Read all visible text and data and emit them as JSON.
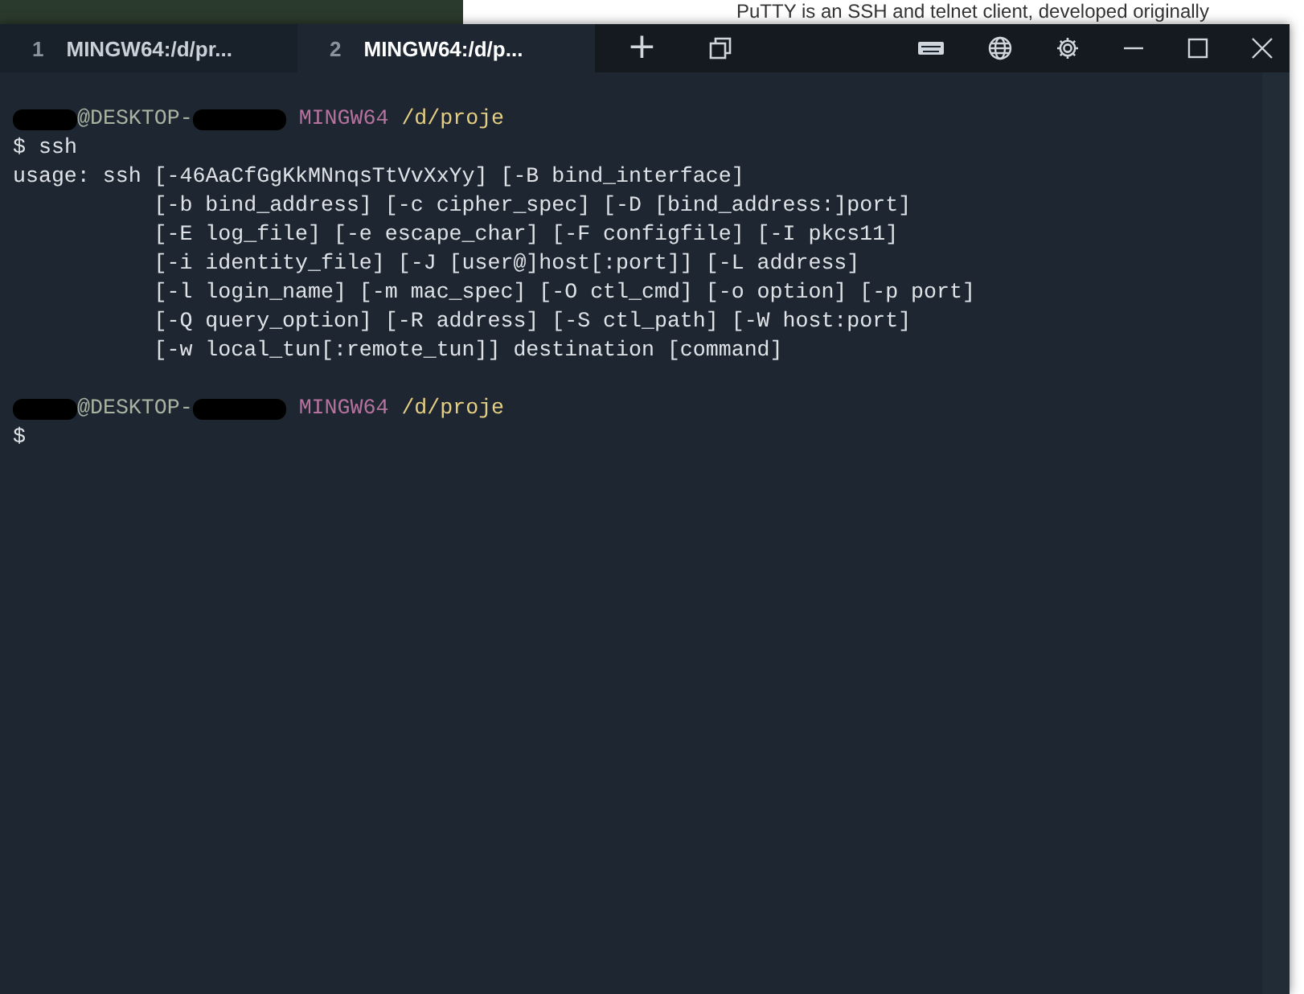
{
  "background": {
    "page_text": "PuTTY is an SSH and telnet client, developed originally"
  },
  "tabs": [
    {
      "number": "1",
      "title": "MINGW64:/d/pr...",
      "selected": false
    },
    {
      "number": "2",
      "title": "MINGW64:/d/p...",
      "selected": true
    }
  ],
  "new_tab": "+",
  "terminal": {
    "lines": [
      {
        "kind": "prompt",
        "host": "@DESKTOP-",
        "shell": "MINGW64",
        "path": "/d/proje"
      },
      {
        "kind": "command",
        "sign": "$",
        "text": "ssh"
      },
      {
        "kind": "output",
        "text": "usage: ssh [-46AaCfGgKkMNnqsTtVvXxYy] [-B bind_interface]"
      },
      {
        "kind": "continuation",
        "text": "[-b bind_address] [-c cipher_spec] [-D [bind_address:]port]"
      },
      {
        "kind": "continuation",
        "text": "[-E log_file] [-e escape_char] [-F configfile] [-I pkcs11]"
      },
      {
        "kind": "continuation",
        "text": "[-i identity_file] [-J [user@]host[:port]] [-L address]"
      },
      {
        "kind": "continuation",
        "text": "[-l login_name] [-m mac_spec] [-O ctl_cmd] [-o option] [-p port]"
      },
      {
        "kind": "continuation",
        "text": "[-Q query_option] [-R address] [-S ctl_path] [-W host:port]"
      },
      {
        "kind": "continuation",
        "text": "[-w local_tun[:remote_tun]] destination [command]"
      },
      {
        "kind": "blank"
      },
      {
        "kind": "prompt",
        "host": "@DESKTOP-",
        "shell": "MINGW64",
        "path": "/d/proje"
      },
      {
        "kind": "command",
        "sign": "$"
      }
    ]
  }
}
